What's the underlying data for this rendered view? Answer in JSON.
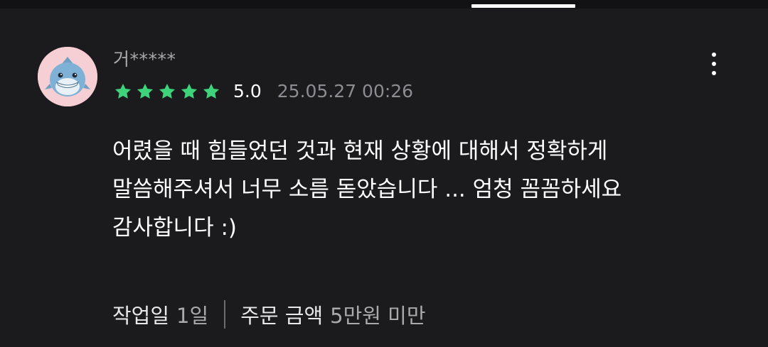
{
  "review": {
    "username": "거*****",
    "rating": 5,
    "score_text": "5.0",
    "date": "25.05.27 00:26",
    "text_lines": [
      "어렸을 때 힘들었던 것과 현재 상황에 대해서 정확하게",
      "말씀해주셔서 너무 소름 돋았습니다 ... 엄청 꼼꼼하세요",
      "감사합니다 :)"
    ],
    "meta": {
      "work_days_label": "작업일",
      "work_days_value": "1일",
      "order_amount_label": "주문 금액",
      "order_amount_value": "5만원 미만"
    }
  },
  "icons": {
    "avatar": "shark-avatar-icon",
    "star": "star-icon",
    "more": "more-vertical-icon"
  },
  "colors": {
    "background": "#1b1b1d",
    "star": "#3ed37a",
    "avatar_bg": "#f6cfd4",
    "muted_text": "#8c8c92"
  }
}
